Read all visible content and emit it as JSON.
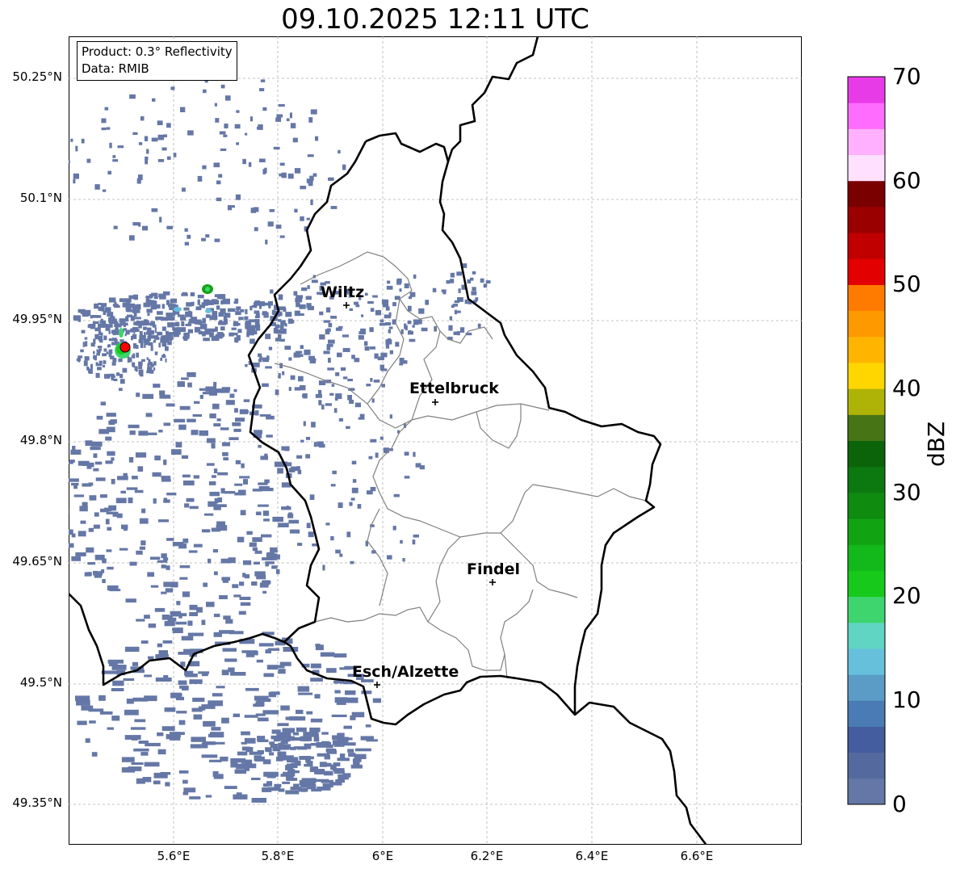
{
  "title": "09.10.2025 12:11 UTC",
  "info": {
    "product": "Product: 0.3° Reflectivity",
    "source": "Data: RMIB"
  },
  "lat_labels": [
    "50.25°N",
    "50.1°N",
    "49.95°N",
    "49.8°N",
    "49.65°N",
    "49.5°N",
    "49.35°N"
  ],
  "lon_labels": [
    "5.6°E",
    "5.8°E",
    "6°E",
    "6.2°E",
    "6.4°E",
    "6.6°E"
  ],
  "cities": [
    {
      "name": "Wiltz"
    },
    {
      "name": "Ettelbruck"
    },
    {
      "name": "Findel"
    },
    {
      "name": "Esch/Alzette"
    }
  ],
  "colorbar": {
    "label": "dBZ",
    "ticks": [
      "70",
      "60",
      "50",
      "40",
      "30",
      "20",
      "10",
      "0"
    ],
    "colors": [
      "#6577a6",
      "#546a9f",
      "#435d9e",
      "#4a7bb4",
      "#5a9cc6",
      "#66c0dc",
      "#60d5c3",
      "#3ed56e",
      "#16c91b",
      "#13b81a",
      "#12a313",
      "#0f8b10",
      "#0c7810",
      "#0b6409",
      "#477516",
      "#b0b307",
      "#ffd600",
      "#ffb500",
      "#ff9900",
      "#ff7b00",
      "#e30000",
      "#c00000",
      "#9b0000",
      "#7a0000",
      "#ffe1ff",
      "#ffb1ff",
      "#ff6dff",
      "#e83be8"
    ]
  },
  "colors": {
    "echo": "#6577a6",
    "border": "#000000",
    "canton": "#808080",
    "grid": "#b0b0b0",
    "radar_site": "#ff0000"
  },
  "icons": [
    "radar-site-icon",
    "city-marker-icon"
  ]
}
